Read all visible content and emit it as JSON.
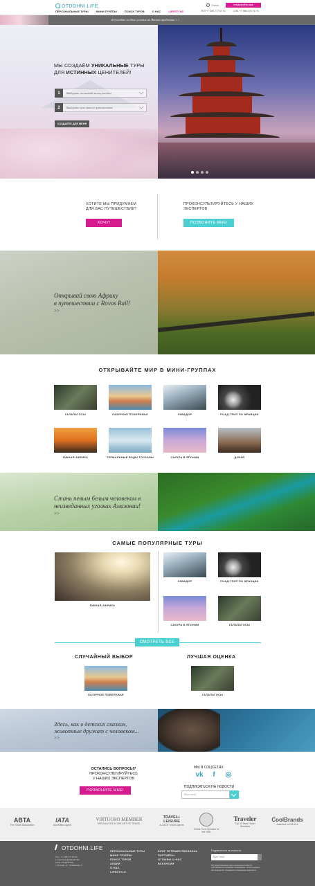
{
  "header": {
    "logo": "OTDOHNI.LIFE",
    "nav": [
      "ПЕРСОНАЛЬНЫЕ ТУРЫ",
      "МИНИ ГРУППЫ",
      "ПОИСК ТУРОВ",
      "О НАС",
      "LIFESTYLE"
    ],
    "search_label": "Поиск...",
    "phone_1": "ТЕЛ +7 495 777 87 01",
    "phone_2": "СПБ +7 986 076 76 76",
    "cta": "ПРИДУМАЙТЕ МНЕ ПУТЕШЕСТВИЕ"
  },
  "strip": {
    "text": "Получайте особые условия на Вашем продлении >>"
  },
  "hero": {
    "title_1": "МЫ СОЗДАЁМ",
    "title_b1": "УНИКАЛЬНЫЕ",
    "title_2": "ТУРЫ ДЛЯ",
    "title_b2": "ИСТИННЫХ",
    "title_3": "ЦЕНИТЕЛЕЙ!",
    "step1_num": "1",
    "step1_text": "Выберите желаемый месяц поездки",
    "step2_num": "2",
    "step2_text": "Выберите цель вашего путешествия",
    "create_btn": "СОЗДАЙТЕ ДЛЯ МЕНЯ"
  },
  "cta": {
    "want_text_1": "ХОТИТЕ МЫ ПРИДУМАЕМ",
    "want_text_2": "ДЛЯ ВАС ПУТЕШЕСТВИЕ?",
    "want_btn": "ХОЧУ!",
    "consult_text_1": "ПРОКОНСУЛЬТИРУЙТЕСЬ У НАШИХ",
    "consult_text_2": "ЭКСПЕРТОВ",
    "consult_btn": "ПОЗВОНИТЕ МНЕ!"
  },
  "africa_banner": {
    "line1": "Открывай свою Африку",
    "line2": "в путешествии с Rovos Rail!",
    "more": ">>"
  },
  "mini_groups": {
    "title": "ОТКРЫВАЙТЕ МИР В МИНИ-ГРУППАХ",
    "tiles": [
      {
        "label": "ГАЛАПАГОСЫ"
      },
      {
        "label": "ЛАЗУРНОЕ ПОБЕРЕЖЬЕ"
      },
      {
        "label": "ЭКВАДОР"
      },
      {
        "label": "РОАД-ТРИП ПО ФРАНЦИИ"
      },
      {
        "label": "ЮЖНАЯ АФРИКА"
      },
      {
        "label": "ТЕРМАЛЬНЫЕ ВОДЫ ТОСКАНЫ"
      },
      {
        "label": "САКУРА В ЯПОНИИ"
      },
      {
        "label": "ДУБАЙ"
      }
    ]
  },
  "amazon_banner": {
    "line1": "Стань певым белым человеком в",
    "line2": "неизведанных уголках Амазонии!",
    "more": ">>"
  },
  "popular": {
    "title": "САМЫЕ ПОПУЛЯРНЫЕ ТУРЫ",
    "big_label": "ЮЖНАЯ АФРИКА",
    "tiles": [
      {
        "label": "ЭКВАДОР"
      },
      {
        "label": "РОАД-ТРИП ПО ФРАНЦИИ"
      },
      {
        "label": "САКУРА В ЯПОНИИ"
      },
      {
        "label": "ГАЛАПАГОСЫ"
      }
    ],
    "see_all": "СМОТРЕТЬ ВСЕ",
    "random_title": "СЛУЧАЙНЫЙ ВЫБОР",
    "random_label": "ЛАЗУРНОЕ ПОБЕРЕЖЬЕ",
    "best_title": "ЛУЧШАЯ ОЦЕНКА",
    "best_label": "ГАЛАПАГОСЫ"
  },
  "seal_banner": {
    "line1": "Здесь, как в детских сказках,",
    "line2": "животные дружат с человеком...",
    "more": ">>"
  },
  "questions": {
    "line1": "ОСТАЛИСЬ ВОПРОСЫ?",
    "line2": "ПРОКОНСУЛЬТИРУЙТЕСЬ",
    "line3": "У НАШИХ ЭКСПЕРТОВ",
    "btn": "ПОЗВОНИТЕ МНЕ!"
  },
  "social": {
    "title": "МЫ В СОЦСЕТЯХ:",
    "icons": [
      "vk-icon",
      "facebook-icon",
      "instagram-icon"
    ],
    "vk": "vk",
    "fb": "f",
    "ig": "◎",
    "news_title": "ПОДПИСАТЬСЯ НА НОВОСТИ",
    "news_placeholder": "Ваш email"
  },
  "partners": [
    {
      "name": "ABTA",
      "caption": "The Travel Association"
    },
    {
      "name": "IATA",
      "caption": "Accredited Agent"
    },
    {
      "name": "VIRTUOSO MEMBER",
      "caption": "SPECIALISTS IN THE ART OF TRAVEL"
    },
    {
      "name": "TRAVEL+ LEISURE",
      "caption": "A-List of Travel Agents"
    },
    {
      "name": "",
      "caption": "Online Tour Operator of the Year"
    },
    {
      "name": "Traveler",
      "caption": "Top 30 Best Travel Websites"
    },
    {
      "name": "CoolBrands",
      "caption": "Awarded in 2013/14"
    }
  ],
  "footer": {
    "logo": "OTDOHNI.LIFE",
    "contact_1": "Тел.: +7 495 777 87 01",
    "contact_2": "e-mail: hello@otdohni.life",
    "contact_3": "ООО «ОТДОХНИ»",
    "contact_4": "г. Москва, ул. Литвинова, 8",
    "col1": [
      "ПЕРСОНАЛЬНЫЕ ТУРЫ",
      "МИНИ ГРУППЫ",
      "ПОИСК ТУРОВ",
      "АКЦИИ",
      "О НАС",
      "LIFESTYLE"
    ],
    "col2": [
      "БЛОГ ПУТЕШЕСТВЕННИКА",
      "ПАРТНЁРЫ",
      "ОТЗЫВЫ О НАС",
      "ВАКАНСИИ"
    ],
    "news_title": "Подписаться на новости",
    "news_placeholder": "Ваш email",
    "legal": "Все представленные здесь материалы являются собственностью компании. Копирование и использование материалов без письменного разрешения запрещено."
  },
  "colors": {
    "magenta": "#d61a8f",
    "cyan": "#4ccfd1",
    "footer": "#5a5a5a"
  }
}
